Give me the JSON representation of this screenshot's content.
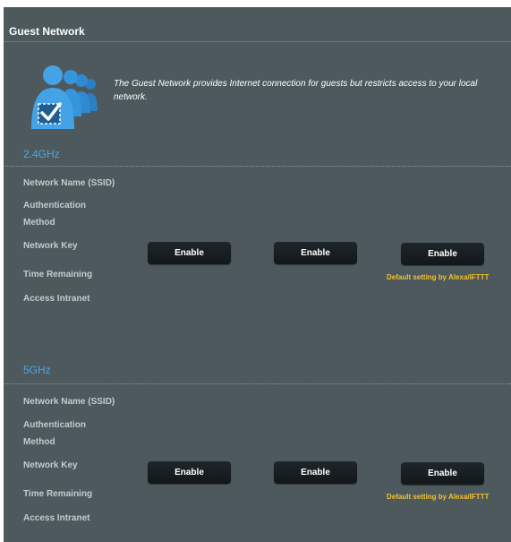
{
  "header": {
    "title": "Guest Network"
  },
  "intro": {
    "text": "The Guest Network provides Internet connection for guests but restricts access to your local network."
  },
  "colors": {
    "panel": "#4d595d",
    "band_title": "#4fa6e3",
    "note": "#f4c12c",
    "button": "#1a2124"
  },
  "bands": [
    {
      "title": "2.4GHz",
      "labels": {
        "ssid": "Network Name (SSID)",
        "auth_line1": "Authentication",
        "auth_line2": "Method",
        "key": "Network Key",
        "time": "Time Remaining",
        "intranet": "Access Intranet"
      },
      "buttons": [
        "Enable",
        "Enable",
        "Enable"
      ],
      "note": "Default setting by Alexa/IFTTT"
    },
    {
      "title": "5GHz",
      "labels": {
        "ssid": "Network Name (SSID)",
        "auth_line1": "Authentication",
        "auth_line2": "Method",
        "key": "Network Key",
        "time": "Time Remaining",
        "intranet": "Access Intranet"
      },
      "buttons": [
        "Enable",
        "Enable",
        "Enable"
      ],
      "note": "Default setting by Alexa/IFTTT"
    }
  ],
  "icons": {
    "intro": "guest-users-check-icon"
  }
}
